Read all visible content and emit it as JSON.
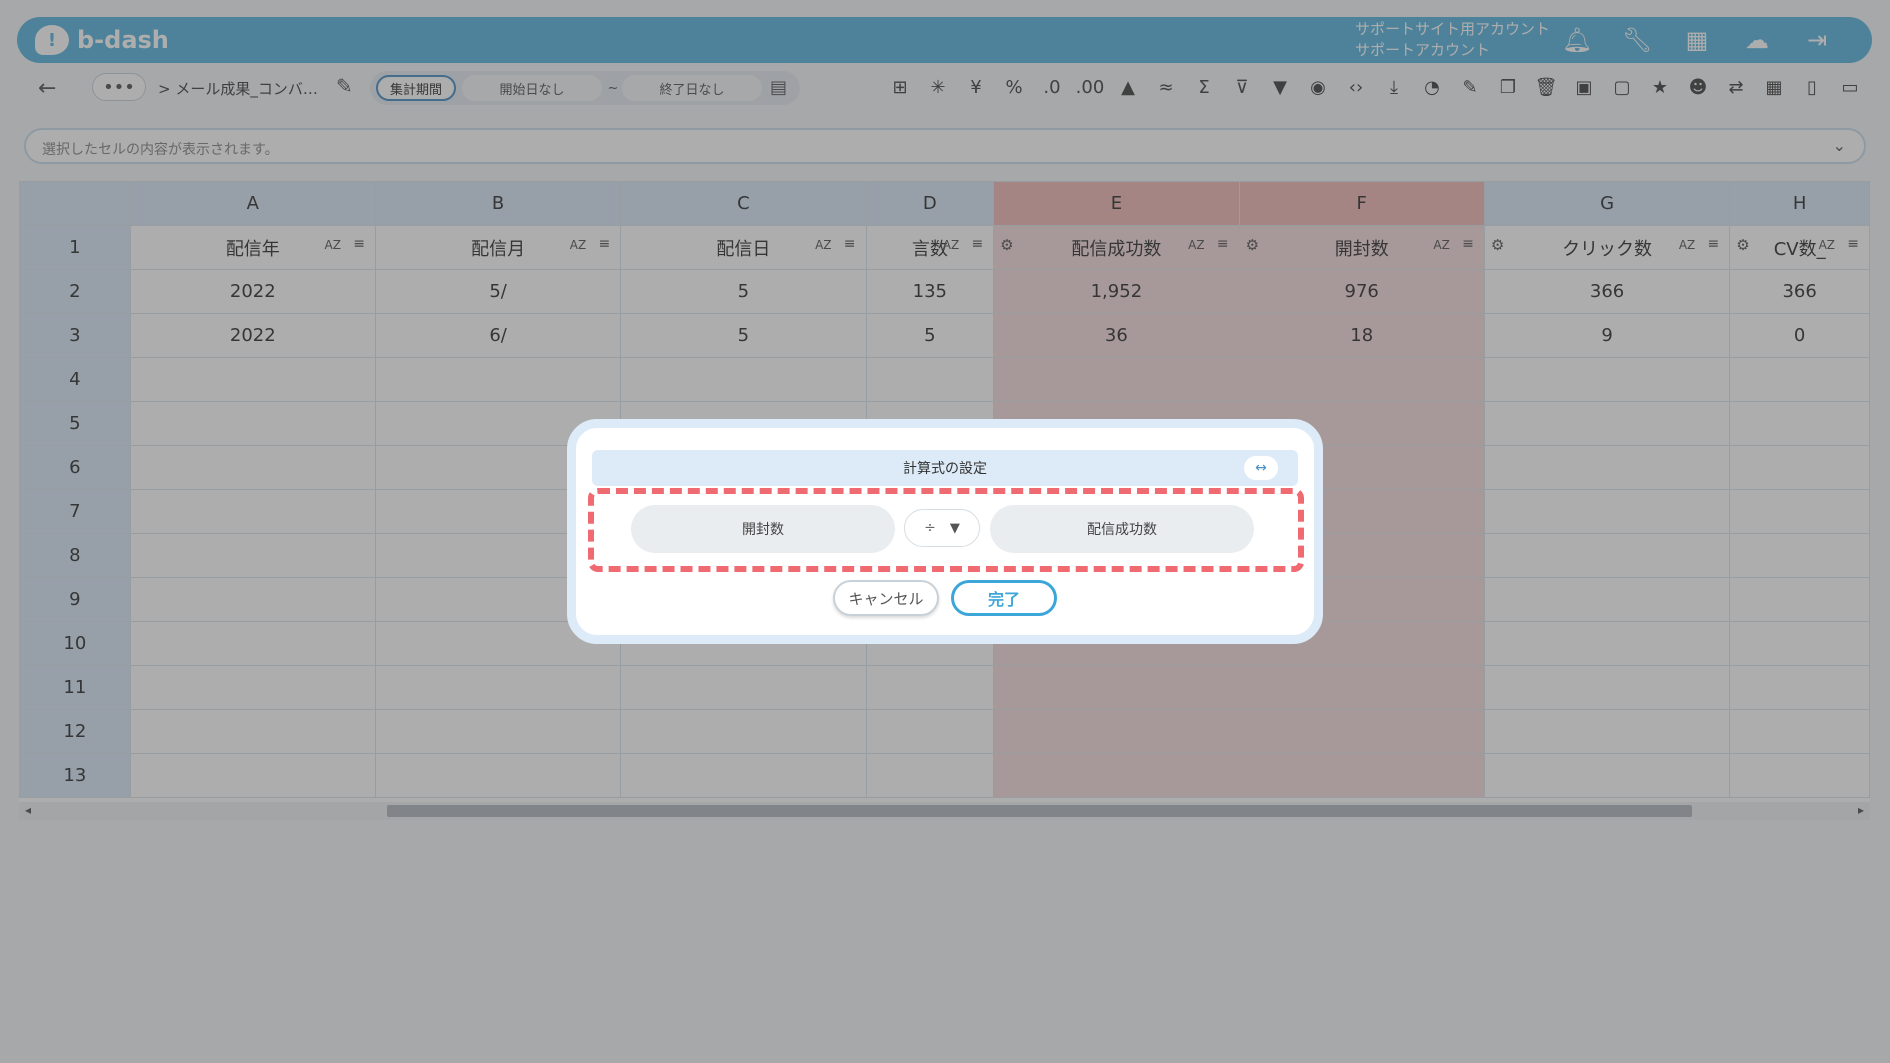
{
  "header": {
    "logo_text": "b-dash",
    "account_line1": "サポートサイト用アカウント",
    "account_line2": "サポートアカウント",
    "icons": [
      "bell-icon",
      "wrench-icon",
      "apps-grid-icon",
      "chat-cloud-icon",
      "logout-icon"
    ]
  },
  "toolbar": {
    "more_label": "•••",
    "breadcrumb": "> メール成果_コンバ…",
    "period_label": "集計期間",
    "start_date": "開始日なし",
    "tilde": "~",
    "end_date": "終了日なし",
    "tool_icons": [
      "table-icon",
      "loading-icon",
      "yen-icon",
      "percent-icon",
      "decimal-decrease-icon",
      "decimal-increase-icon",
      "number-format-icon",
      "rounding-icon",
      "sum-icon",
      "filter-clear-icon",
      "filter-icon",
      "eye-icon",
      "code-icon",
      "download-icon",
      "chart-icon",
      "edit-icon",
      "copy-icon",
      "trash-icon",
      "archive-icon",
      "unarchive-icon",
      "star-icon",
      "user-check-icon",
      "swap-icon",
      "calendar-icon",
      "document-icon",
      "clipboard-icon"
    ]
  },
  "cellbar": {
    "placeholder": "選択したセルの内容が表示されます。"
  },
  "grid": {
    "columns": [
      {
        "letter": "A",
        "field": "配信年",
        "highlight": false
      },
      {
        "letter": "B",
        "field": "配信月",
        "highlight": false
      },
      {
        "letter": "C",
        "field": "配信日",
        "highlight": false
      },
      {
        "letter": "D",
        "field": "言数",
        "highlight": false
      },
      {
        "letter": "E",
        "field": "配信成功数",
        "highlight": true
      },
      {
        "letter": "F",
        "field": "開封数",
        "highlight": true
      },
      {
        "letter": "G",
        "field": "クリック数",
        "highlight": false
      },
      {
        "letter": "H",
        "field": "CV数_",
        "highlight": false
      }
    ],
    "row_numbers": [
      "1",
      "2",
      "3",
      "4",
      "5",
      "6",
      "7",
      "8",
      "9",
      "10",
      "11",
      "12",
      "13"
    ],
    "rows": [
      [
        "2022",
        "5/",
        "5",
        "135",
        "1,952",
        "976",
        "366",
        "366"
      ],
      [
        "2022",
        "6/",
        "5",
        "5",
        "36",
        "18",
        "9",
        "0"
      ]
    ],
    "sort_label": "AZ"
  },
  "modal": {
    "title": "計算式の設定",
    "resize_symbol": "↔",
    "left_operand": "開封数",
    "operator": "÷",
    "right_operand": "配信成功数",
    "cancel_label": "キャンセル",
    "done_label": "完了"
  },
  "colors": {
    "header_blue": "#5bb6df",
    "highlight_red": "#f1b9b9",
    "dash_red": "#f06a72",
    "done_blue": "#3da6d9"
  }
}
